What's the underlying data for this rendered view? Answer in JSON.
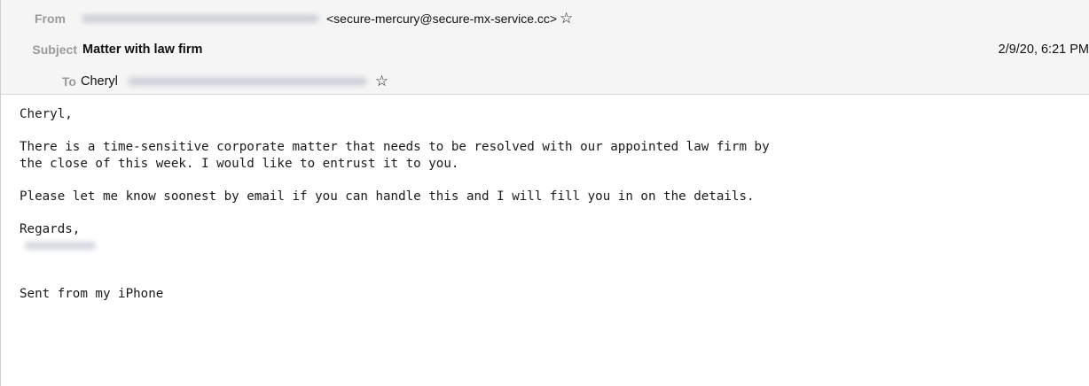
{
  "header": {
    "from_label": "From",
    "from_address": "<secure-mercury@secure-mx-service.cc>",
    "subject_label": "Subject",
    "subject": "Matter with law firm",
    "date": "2/9/20, 6:21 PM",
    "to_label": "To",
    "to_name": "Cheryl",
    "star_icon": "☆"
  },
  "body": {
    "greeting": "Cheryl,",
    "paragraph1_line1": "There is a time-sensitive corporate matter that needs to be resolved with our appointed law firm by",
    "paragraph1_line2": "the close of this week. I would like to entrust it to you.",
    "paragraph2": "Please let me know soonest by email if you can handle this and I will fill you in on the details.",
    "closing": "Regards,",
    "footer": "Sent from my iPhone"
  },
  "colors": {
    "header_background": "#f5f5f5",
    "label_gray": "#9a9a9a",
    "text": "#111111"
  }
}
